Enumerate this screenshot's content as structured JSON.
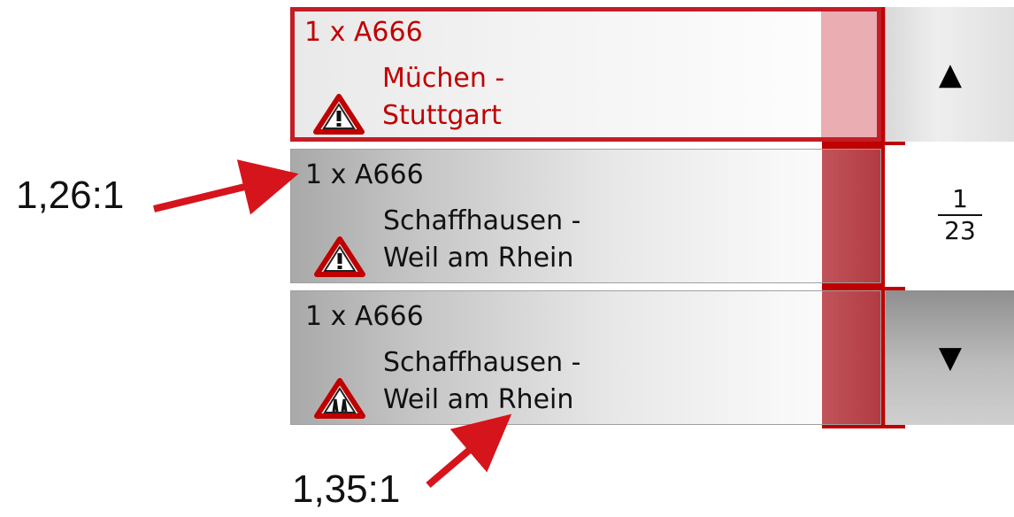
{
  "colors": {
    "accent": "#c00000",
    "selected_text": "#c00000"
  },
  "list": {
    "items": [
      {
        "route": "1 x A666",
        "description_line1": "Müchen -",
        "description_line2": "Stuttgart",
        "icon": "warning-triangle-icon",
        "selected": true
      },
      {
        "route": "1 x A666",
        "description_line1": "Schaffhausen -",
        "description_line2": "Weil am Rhein",
        "icon": "warning-triangle-icon",
        "selected": false
      },
      {
        "route": "1 x A666",
        "description_line1": "Schaffhausen -",
        "description_line2": "Weil am Rhein",
        "icon": "lane-narrowing-icon",
        "selected": false
      }
    ]
  },
  "scroll": {
    "up_icon": "▲",
    "down_icon": "▼",
    "page_current": "1",
    "page_total": "23"
  },
  "annotations": {
    "top_label": "1,26:1",
    "bottom_label": "1,35:1"
  }
}
